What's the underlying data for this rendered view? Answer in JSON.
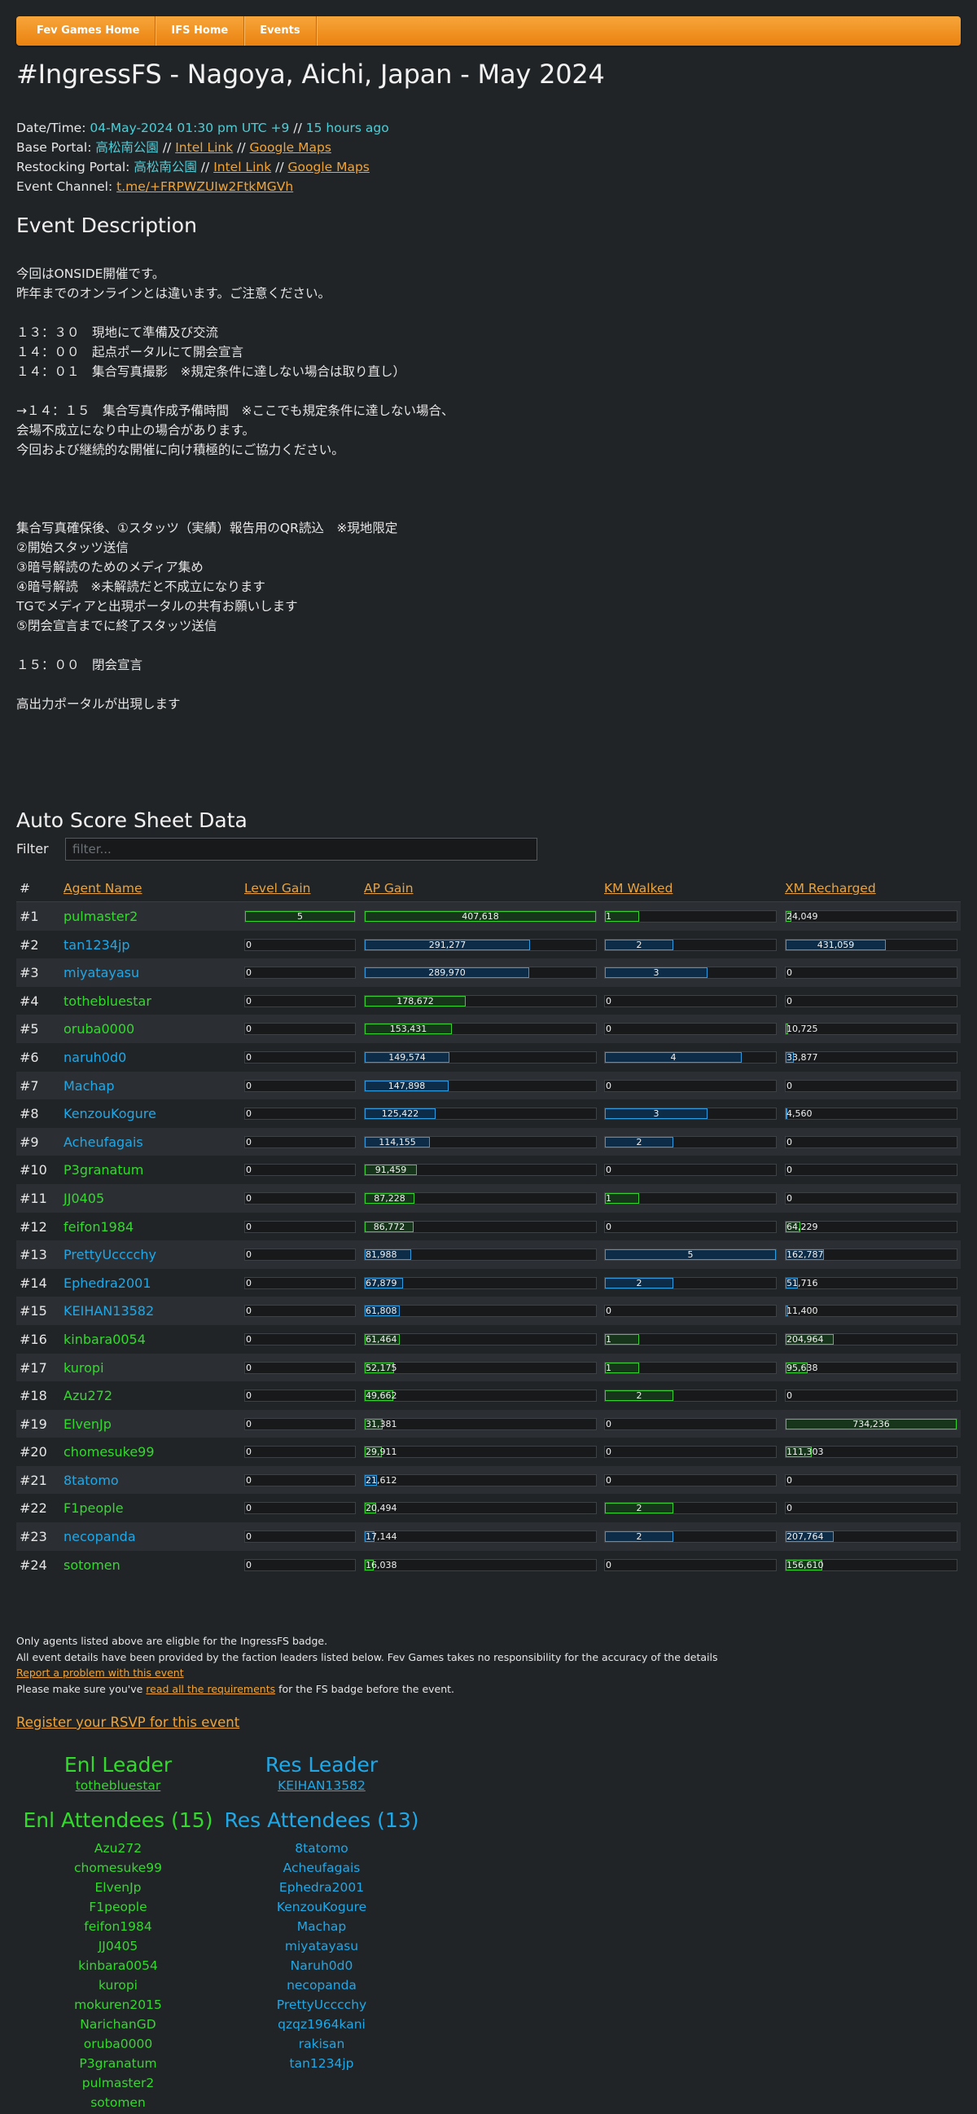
{
  "nav": [
    "Fev Games Home",
    "IFS Home",
    "Events"
  ],
  "title": "#IngressFS - Nagoya, Aichi, Japan - May 2024",
  "info": {
    "datetime_label": "Date/Time:",
    "datetime": "04-May-2024 01:30 pm UTC +9",
    "sep": "//",
    "ago": "15 hours ago",
    "base_label": "Base Portal:",
    "base_portal": "高松南公園",
    "restock_label": "Restocking Portal:",
    "restock_portal": "高松南公園",
    "intel": "Intel Link",
    "maps": "Google Maps",
    "channel_label": "Event Channel:",
    "channel": "t.me/+FRPWZUIw2FtkMGVh"
  },
  "description_heading": "Event Description",
  "description_lines": [
    "今回はONSIDE開催です。",
    "昨年までのオンラインとは違います。ご注意ください。",
    "",
    "１３：３０　現地にて準備及び交流",
    "１４：００　起点ポータルにて開会宣言",
    "１４：０１　集合写真撮影　※規定条件に達しない場合は取り直し）",
    "",
    "→１４：１５　集合写真作成予備時間　※ここでも規定条件に達しない場合、",
    "会場不成立になり中止の場合があります。",
    "今回および継続的な開催に向け積極的にご協力ください。",
    "",
    "",
    "",
    "集合写真確保後、①スタッツ（実績）報告用のQR読込　※現地限定",
    "②開始スタッツ送信",
    "③暗号解読のためのメディア集め",
    "④暗号解読　※未解読だと不成立になります",
    "TGでメディアと出現ポータルの共有お願いします",
    "⑤閉会宣言までに終了スタッツ送信",
    "",
    "１５：００　閉会宣言",
    "",
    "高出力ポータルが出現します"
  ],
  "score_heading": "Auto Score Sheet Data",
  "filter": {
    "label": "Filter",
    "placeholder": "filter..."
  },
  "table": {
    "headers": [
      "#",
      "Agent Name",
      "Level Gain",
      "AP Gain",
      "KM Walked",
      "XM Recharged"
    ],
    "max": {
      "level": 5,
      "ap": 407618,
      "km": 5,
      "xm": 734236
    },
    "rows": [
      {
        "rank": "#1",
        "name": "pulmaster2",
        "team": "enl",
        "level": 5,
        "level_text": "5",
        "ap": 407618,
        "ap_text": "407,618",
        "km": 1,
        "km_text": "1",
        "xm": 24049,
        "xm_text": "24,049"
      },
      {
        "rank": "#2",
        "name": "tan1234jp",
        "team": "res",
        "level": 0,
        "level_text": "0",
        "ap": 291277,
        "ap_text": "291,277",
        "km": 2,
        "km_text": "2",
        "xm": 431059,
        "xm_text": "431,059"
      },
      {
        "rank": "#3",
        "name": "miyatayasu",
        "team": "res",
        "level": 0,
        "level_text": "0",
        "ap": 289970,
        "ap_text": "289,970",
        "km": 3,
        "km_text": "3",
        "xm": 0,
        "xm_text": "0"
      },
      {
        "rank": "#4",
        "name": "tothebluestar",
        "team": "enl",
        "level": 0,
        "level_text": "0",
        "ap": 178672,
        "ap_text": "178,672",
        "km": 0,
        "km_text": "0",
        "xm": 0,
        "xm_text": "0"
      },
      {
        "rank": "#5",
        "name": "oruba0000",
        "team": "enl",
        "level": 0,
        "level_text": "0",
        "ap": 153431,
        "ap_text": "153,431",
        "km": 0,
        "km_text": "0",
        "xm": 10725,
        "xm_text": "10,725"
      },
      {
        "rank": "#6",
        "name": "naruh0d0",
        "team": "res",
        "level": 0,
        "level_text": "0",
        "ap": 149574,
        "ap_text": "149,574",
        "km": 4,
        "km_text": "4",
        "xm": 33877,
        "xm_text": "33,877"
      },
      {
        "rank": "#7",
        "name": "Machap",
        "team": "res",
        "level": 0,
        "level_text": "0",
        "ap": 147898,
        "ap_text": "147,898",
        "km": 0,
        "km_text": "0",
        "xm": 0,
        "xm_text": "0"
      },
      {
        "rank": "#8",
        "name": "KenzouKogure",
        "team": "res",
        "level": 0,
        "level_text": "0",
        "ap": 125422,
        "ap_text": "125,422",
        "km": 3,
        "km_text": "3",
        "xm": 4560,
        "xm_text": "4,560"
      },
      {
        "rank": "#9",
        "name": "Acheufagais",
        "team": "res",
        "level": 0,
        "level_text": "0",
        "ap": 114155,
        "ap_text": "114,155",
        "km": 2,
        "km_text": "2",
        "xm": 0,
        "xm_text": "0"
      },
      {
        "rank": "#10",
        "name": "P3granatum",
        "team": "enl",
        "level": 0,
        "level_text": "0",
        "ap": 91459,
        "ap_text": "91,459",
        "km": 0,
        "km_text": "0",
        "xm": 0,
        "xm_text": "0"
      },
      {
        "rank": "#11",
        "name": "JJ0405",
        "team": "enl",
        "level": 0,
        "level_text": "0",
        "ap": 87228,
        "ap_text": "87,228",
        "km": 1,
        "km_text": "1",
        "xm": 0,
        "xm_text": "0"
      },
      {
        "rank": "#12",
        "name": "feifon1984",
        "team": "enl",
        "level": 0,
        "level_text": "0",
        "ap": 86772,
        "ap_text": "86,772",
        "km": 0,
        "km_text": "0",
        "xm": 64229,
        "xm_text": "64,229"
      },
      {
        "rank": "#13",
        "name": "PrettyUcccchy",
        "team": "res",
        "level": 0,
        "level_text": "0",
        "ap": 81988,
        "ap_text": "81,988",
        "km": 5,
        "km_text": "5",
        "xm": 162787,
        "xm_text": "162,787"
      },
      {
        "rank": "#14",
        "name": "Ephedra2001",
        "team": "res",
        "level": 0,
        "level_text": "0",
        "ap": 67879,
        "ap_text": "67,879",
        "km": 2,
        "km_text": "2",
        "xm": 51716,
        "xm_text": "51,716"
      },
      {
        "rank": "#15",
        "name": "KEIHAN13582",
        "team": "res",
        "level": 0,
        "level_text": "0",
        "ap": 61808,
        "ap_text": "61,808",
        "km": 0,
        "km_text": "0",
        "xm": 11400,
        "xm_text": "11,400"
      },
      {
        "rank": "#16",
        "name": "kinbara0054",
        "team": "enl",
        "level": 0,
        "level_text": "0",
        "ap": 61464,
        "ap_text": "61,464",
        "km": 1,
        "km_text": "1",
        "xm": 204964,
        "xm_text": "204,964"
      },
      {
        "rank": "#17",
        "name": "kuropi",
        "team": "enl",
        "level": 0,
        "level_text": "0",
        "ap": 52175,
        "ap_text": "52,175",
        "km": 1,
        "km_text": "1",
        "xm": 95638,
        "xm_text": "95,638"
      },
      {
        "rank": "#18",
        "name": "Azu272",
        "team": "enl",
        "level": 0,
        "level_text": "0",
        "ap": 49662,
        "ap_text": "49,662",
        "km": 2,
        "km_text": "2",
        "xm": 0,
        "xm_text": "0"
      },
      {
        "rank": "#19",
        "name": "ElvenJp",
        "team": "enl",
        "level": 0,
        "level_text": "0",
        "ap": 31381,
        "ap_text": "31,381",
        "km": 0,
        "km_text": "0",
        "xm": 734236,
        "xm_text": "734,236"
      },
      {
        "rank": "#20",
        "name": "chomesuke99",
        "team": "enl",
        "level": 0,
        "level_text": "0",
        "ap": 29911,
        "ap_text": "29,911",
        "km": 0,
        "km_text": "0",
        "xm": 111303,
        "xm_text": "111,303"
      },
      {
        "rank": "#21",
        "name": "8tatomo",
        "team": "res",
        "level": 0,
        "level_text": "0",
        "ap": 21612,
        "ap_text": "21,612",
        "km": 0,
        "km_text": "0",
        "xm": 0,
        "xm_text": "0"
      },
      {
        "rank": "#22",
        "name": "F1people",
        "team": "enl",
        "level": 0,
        "level_text": "0",
        "ap": 20494,
        "ap_text": "20,494",
        "km": 2,
        "km_text": "2",
        "xm": 0,
        "xm_text": "0"
      },
      {
        "rank": "#23",
        "name": "necopanda",
        "team": "res",
        "level": 0,
        "level_text": "0",
        "ap": 17144,
        "ap_text": "17,144",
        "km": 2,
        "km_text": "2",
        "xm": 207764,
        "xm_text": "207,764"
      },
      {
        "rank": "#24",
        "name": "sotomen",
        "team": "enl",
        "level": 0,
        "level_text": "0",
        "ap": 16038,
        "ap_text": "16,038",
        "km": 0,
        "km_text": "0",
        "xm": 156610,
        "xm_text": "156,610"
      }
    ]
  },
  "notes": {
    "line1": "Only agents listed above are eligble for the IngressFS badge.",
    "line2": "All event details have been provided by the faction leaders listed below. Fev Games takes no responsibility for the accuracy of the details",
    "report": "Report a problem with this event",
    "line4_pre": "Please make sure you've",
    "line4_link": "read all the requirements",
    "line4_post": "for the FS badge before the event."
  },
  "rsvp": "Register your RSVP for this event",
  "enl": {
    "leader_heading": "Enl Leader",
    "leader": "tothebluestar",
    "attendees_heading": "Enl Attendees (15)",
    "attendees": [
      "Azu272",
      "chomesuke99",
      "ElvenJp",
      "F1people",
      "feifon1984",
      "JJ0405",
      "kinbara0054",
      "kuropi",
      "mokuren2015",
      "NarichanGD",
      "oruba0000",
      "P3granatum",
      "pulmaster2",
      "sotomen"
    ]
  },
  "res": {
    "leader_heading": "Res Leader",
    "leader": "KEIHAN13582",
    "attendees_heading": "Res Attendees (13)",
    "attendees": [
      "8tatomo",
      "Acheufagais",
      "Ephedra2001",
      "KenzouKogure",
      "Machap",
      "miyatayasu",
      "Naruh0d0",
      "necopanda",
      "PrettyUcccchy",
      "qzqz1964kani",
      "rakisan",
      "tan1234jp"
    ]
  },
  "colors": {
    "enl": "#34d92e",
    "res": "#1fa8e8",
    "accent": "#f0a437",
    "background": "#212427"
  }
}
